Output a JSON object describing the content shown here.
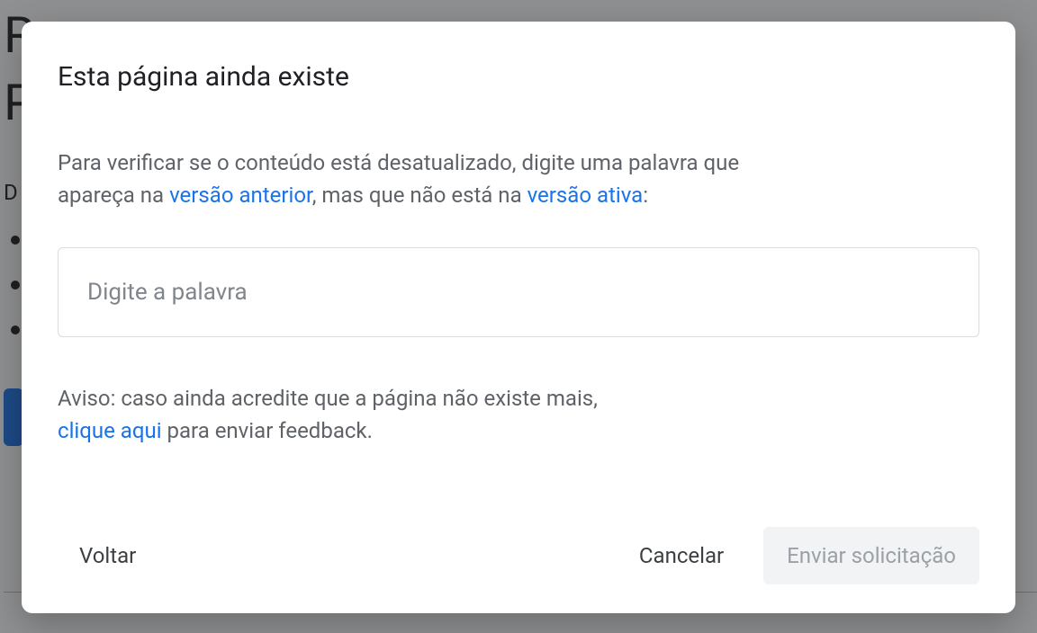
{
  "background": {
    "line1": "R",
    "line2": "P",
    "d": "D"
  },
  "dialog": {
    "title": "Esta página ainda existe",
    "intro_part1": "Para verificar se o conteúdo está desatualizado, digite uma palavra que apareça na ",
    "link_prev": "versão anterior",
    "intro_part2": ", mas que não está na ",
    "link_live": "versão ativa",
    "intro_part3": ":",
    "input_placeholder": "Digite a palavra",
    "warning_part1": "Aviso: caso ainda acredite que a página não existe mais, ",
    "warning_link": "clique aqui",
    "warning_part2": " para enviar feedback.",
    "back": "Voltar",
    "cancel": "Cancelar",
    "submit": "Enviar solicitação"
  }
}
